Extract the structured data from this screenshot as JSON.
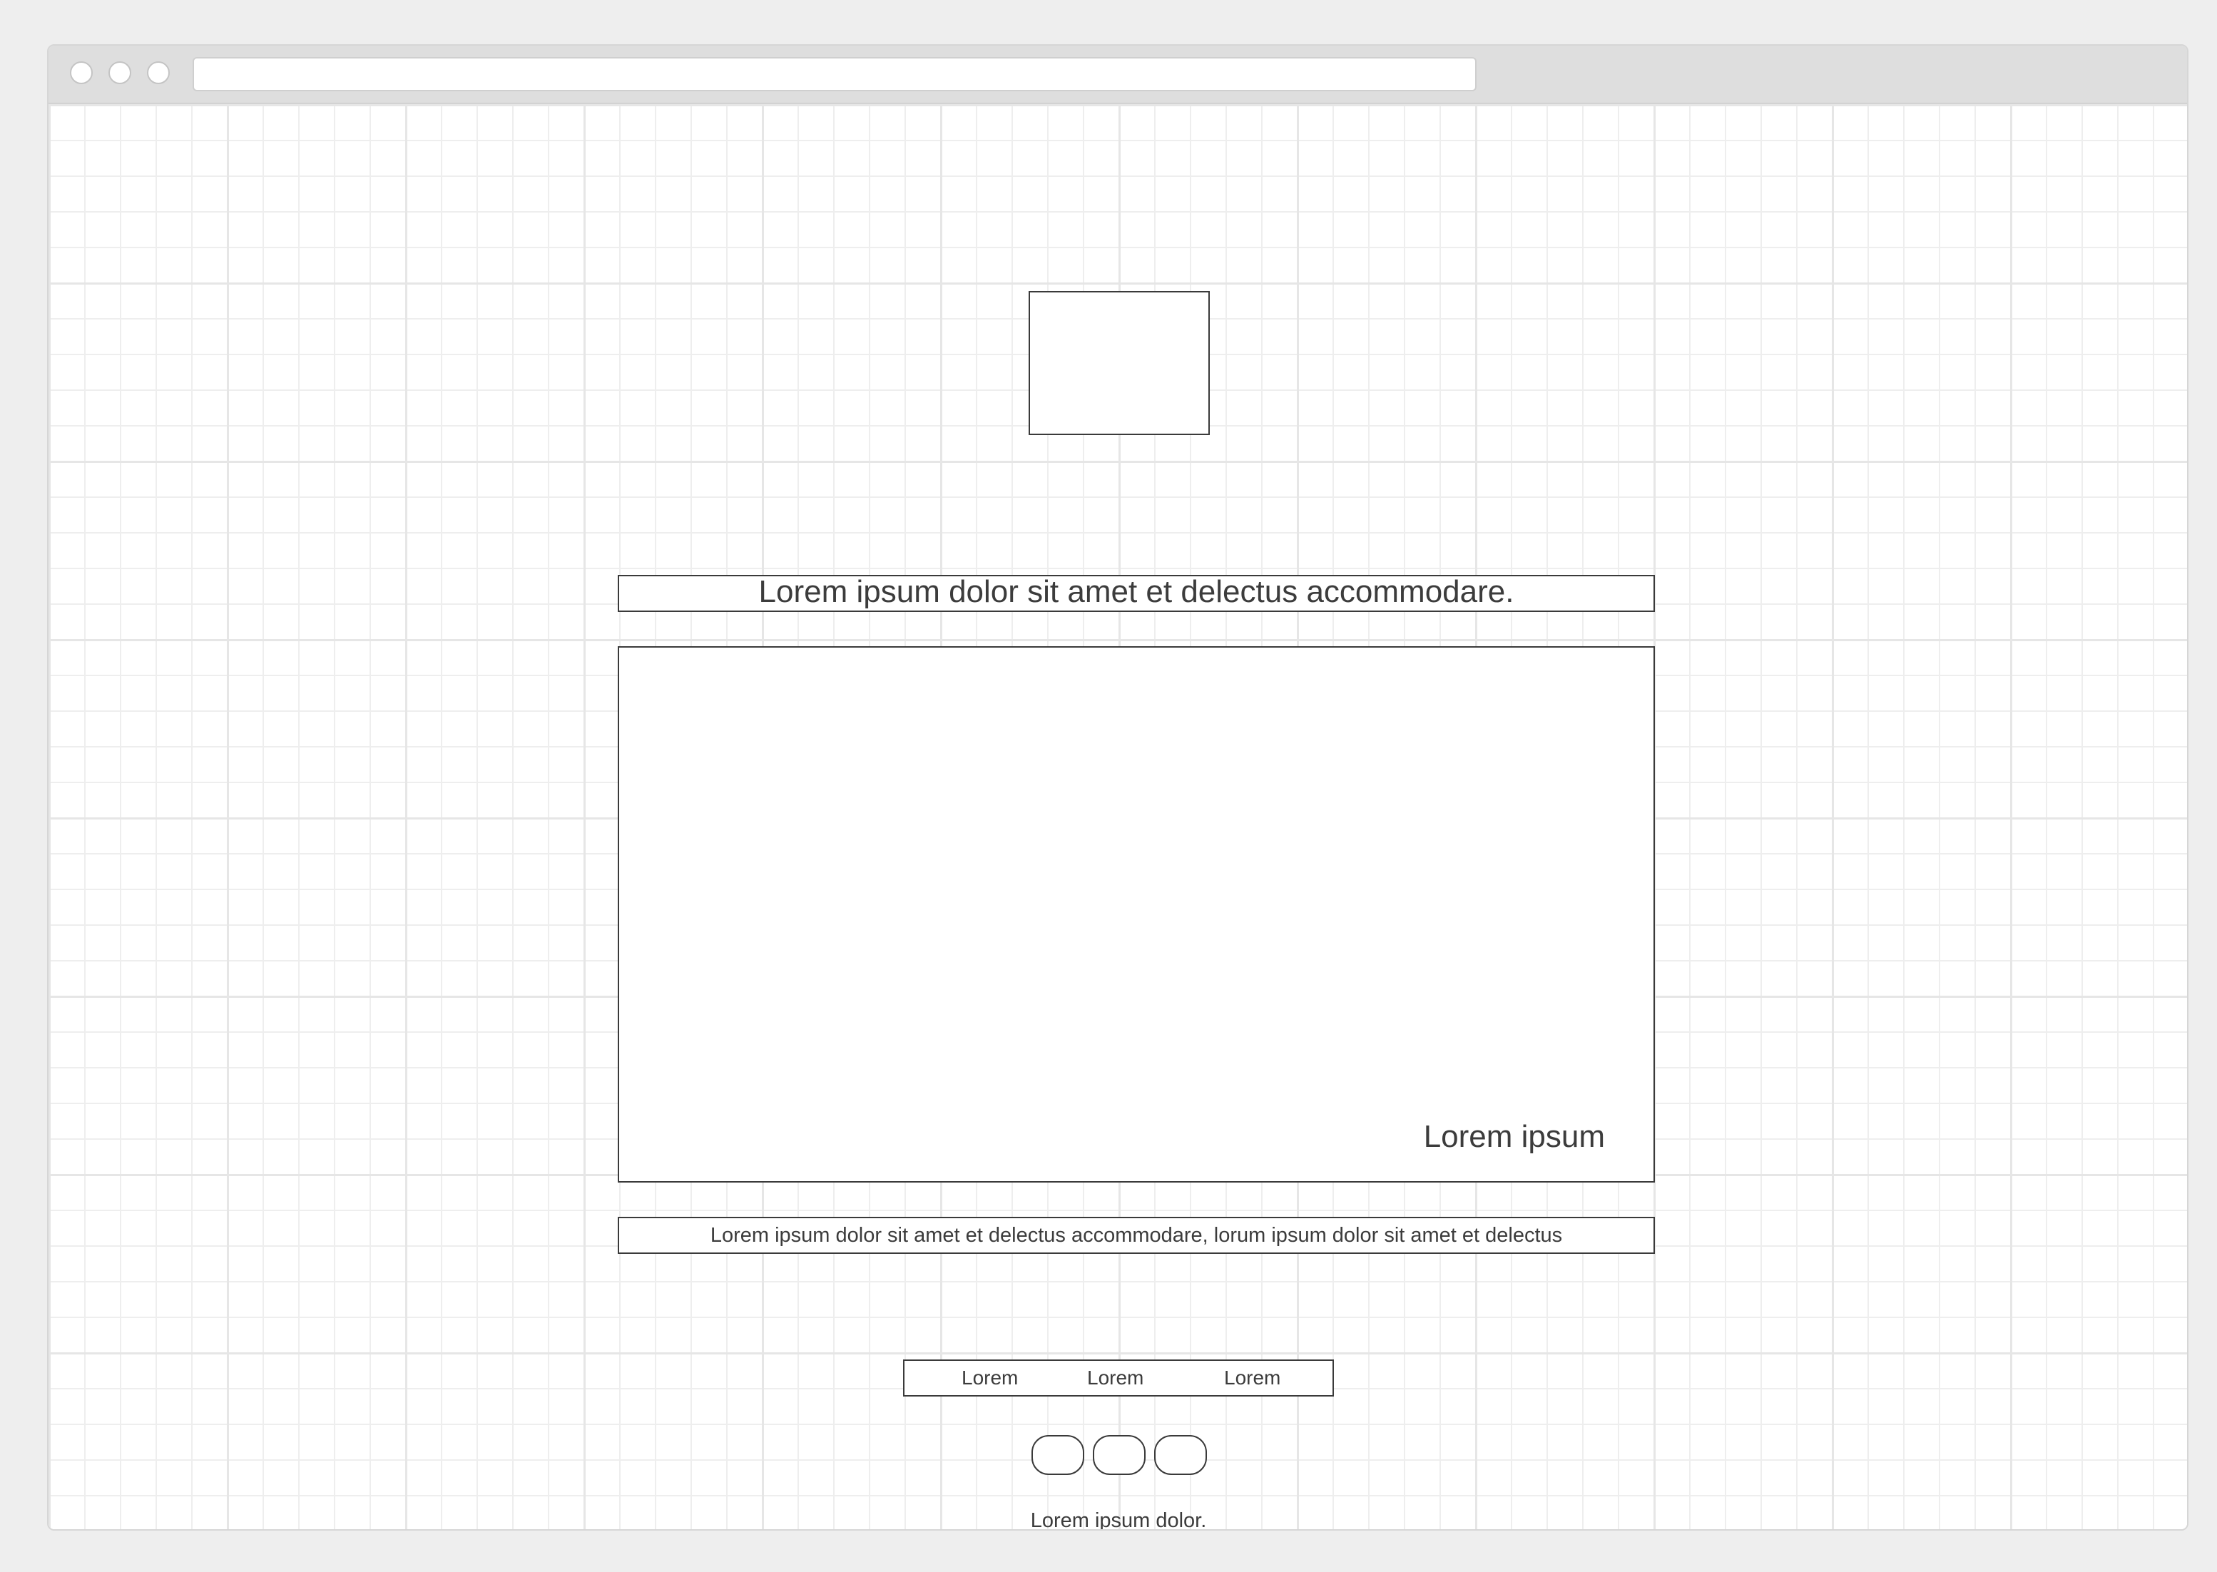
{
  "browser": {
    "address_value": "",
    "window_controls": [
      "close-icon",
      "minimize-icon",
      "maximize-icon"
    ]
  },
  "page": {
    "headline": "Lorem ipsum dolor sit amet et delectus accommodare.",
    "hero_caption": "Lorem ipsum",
    "description": "Lorem ipsum dolor sit amet et delectus accommodare, lorum ipsum dolor sit amet et delectus",
    "nav_items": [
      "Lorem",
      "Lorem",
      "Lorem"
    ],
    "footer_text": "Lorem ipsum dolor."
  },
  "colors": {
    "page_background": "#eeeeee",
    "titlebar": "#dedede",
    "grid_major": "#e6e6e6",
    "grid_minor": "#eeeeee",
    "outline": "#3a3a3a",
    "text": "#3c3c3c"
  }
}
